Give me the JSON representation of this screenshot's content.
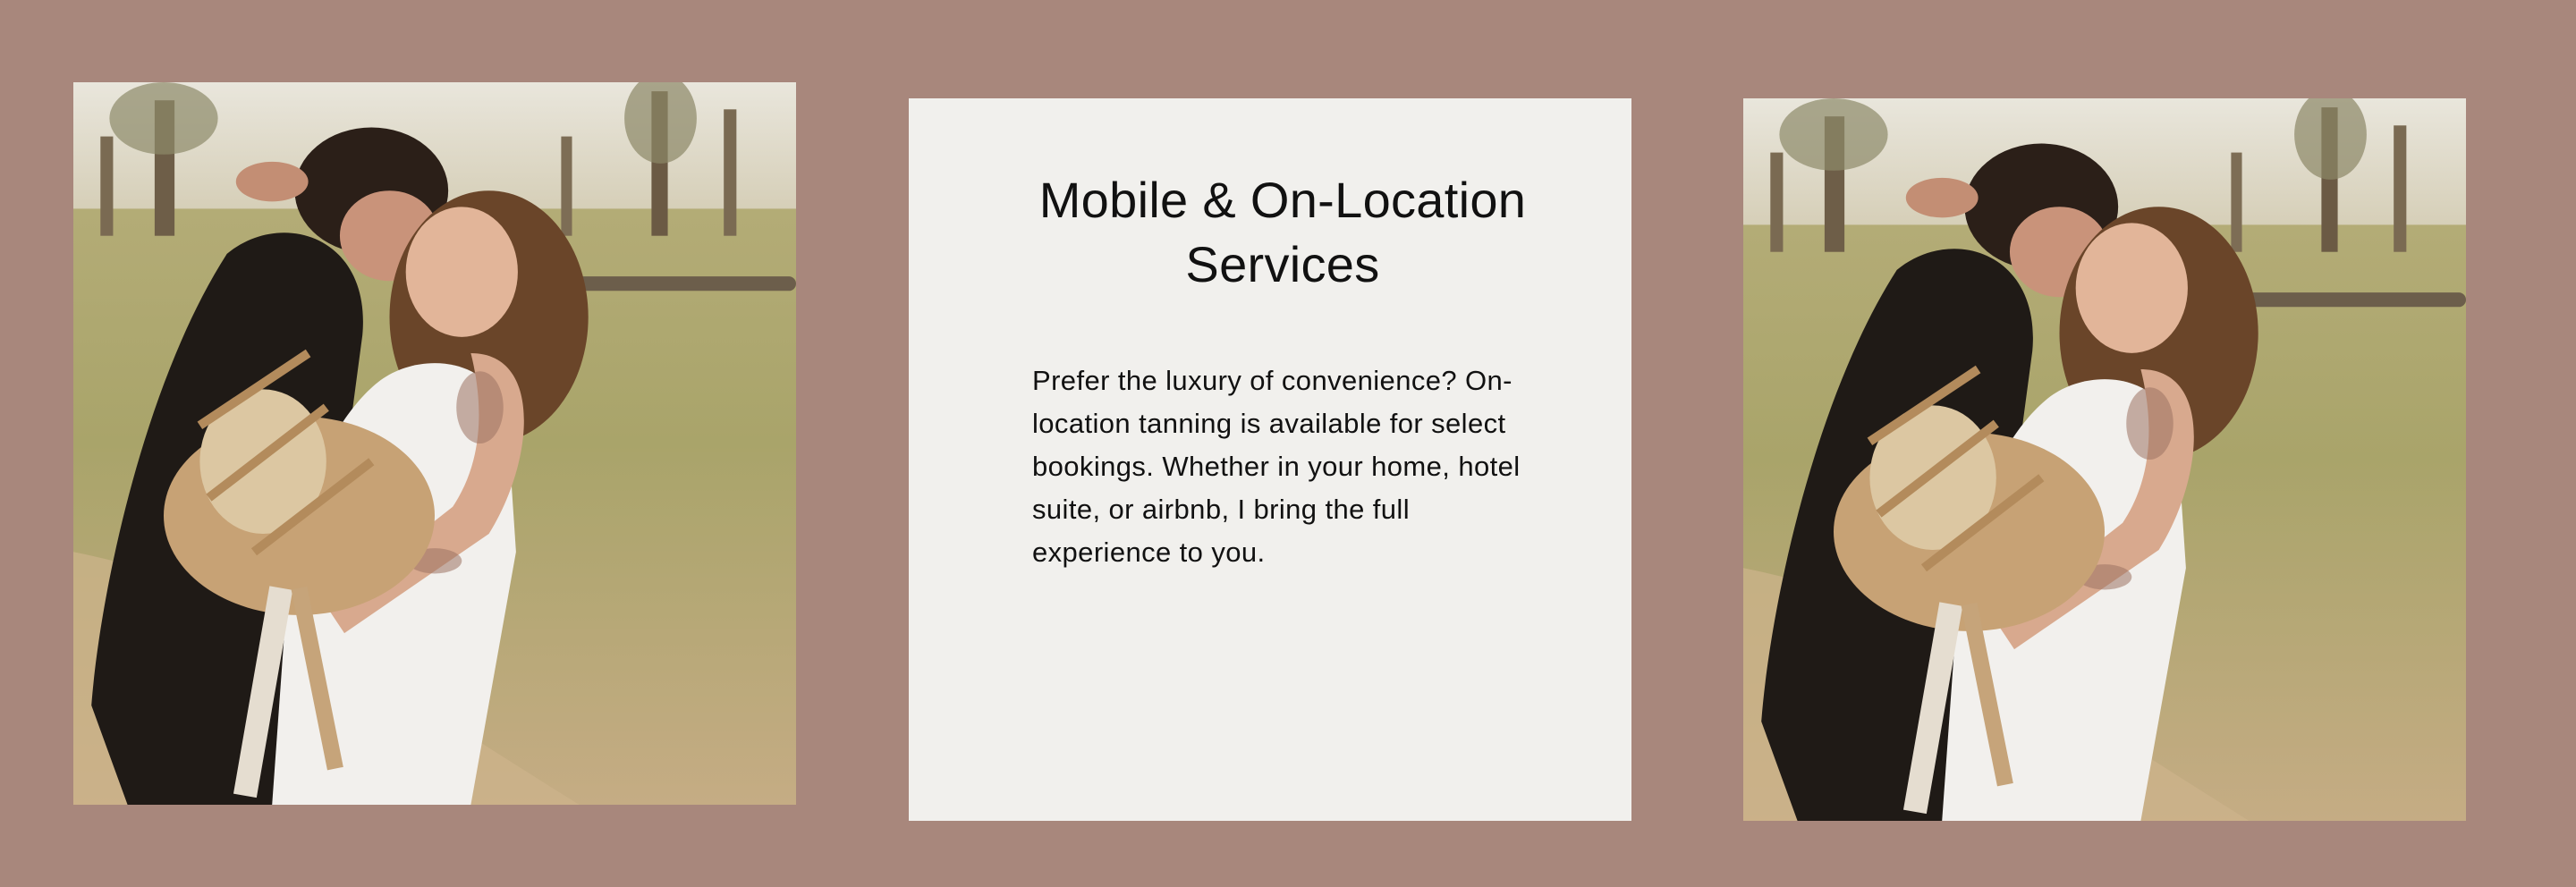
{
  "section": {
    "background_color": "#a8877c",
    "card_color": "#f1f0ed",
    "title": "Mobile & On-Location Services",
    "body": "Prefer the luxury of convenience? On-location tanning is available for select bookings. Whether in your home, hotel suite, or airbnb, I bring the full experience to you."
  },
  "images": {
    "left": {
      "description": "couple-embracing-with-dried-flower-bouquet"
    },
    "right": {
      "description": "couple-embracing-with-dried-flower-bouquet"
    }
  }
}
